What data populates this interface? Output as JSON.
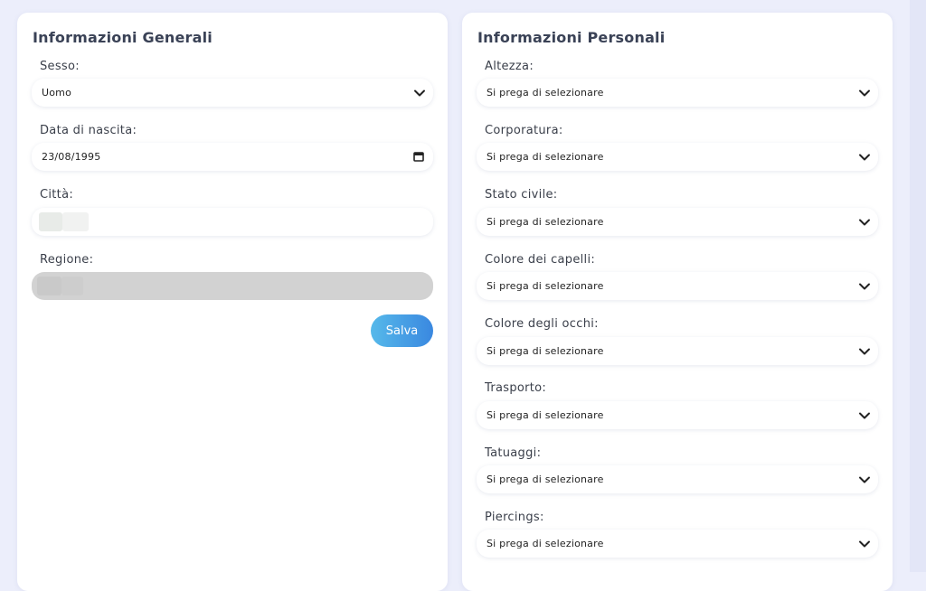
{
  "general": {
    "title": "Informazioni Generali",
    "fields": {
      "sesso": {
        "label": "Sesso:",
        "value": "Uomo"
      },
      "nascita": {
        "label": "Data di nascita:",
        "value": "23/08/1995"
      },
      "citta": {
        "label": "Città:"
      },
      "regione": {
        "label": "Regione:"
      }
    },
    "save_label": "Salva"
  },
  "personal": {
    "title": "Informazioni Personali",
    "fields": [
      {
        "label": "Altezza:",
        "value": "Si prega di selezionare"
      },
      {
        "label": "Corporatura:",
        "value": "Si prega di selezionare"
      },
      {
        "label": "Stato civile:",
        "value": "Si prega di selezionare"
      },
      {
        "label": "Colore dei capelli:",
        "value": "Si prega di selezionare"
      },
      {
        "label": "Colore degli occhi:",
        "value": "Si prega di selezionare"
      },
      {
        "label": "Trasporto:",
        "value": "Si prega di selezionare"
      },
      {
        "label": "Tatuaggi:",
        "value": "Si prega di selezionare"
      },
      {
        "label": "Piercings:",
        "value": "Si prega di selezionare"
      }
    ]
  },
  "colors": {
    "background": "#eceefb",
    "card": "#ffffff",
    "title": "#3a4256",
    "button_gradient_start": "#56b9ea",
    "button_gradient_end": "#3a88e0",
    "disabled_field": "#d2d2d2"
  }
}
